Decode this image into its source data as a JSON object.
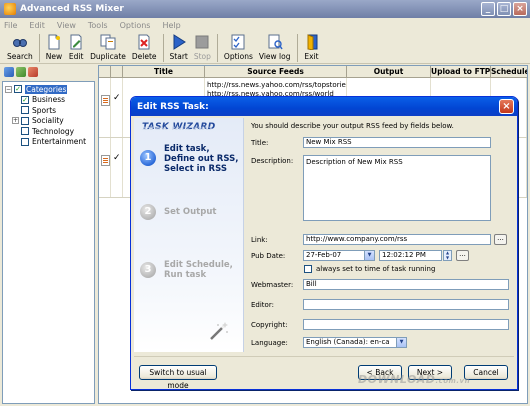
{
  "app": {
    "title": "Advanced RSS Mixer",
    "window_buttons": [
      "_",
      "□",
      "×"
    ]
  },
  "menu": [
    "File",
    "Edit",
    "View",
    "Tools",
    "Options",
    "Help"
  ],
  "toolbar": [
    {
      "label": "Search",
      "icon": "search-icon",
      "enabled": true
    },
    {
      "label": "New",
      "icon": "new-icon",
      "enabled": true
    },
    {
      "label": "Edit",
      "icon": "edit-icon",
      "enabled": true
    },
    {
      "label": "Duplicate",
      "icon": "duplicate-icon",
      "enabled": true
    },
    {
      "label": "Delete",
      "icon": "delete-icon",
      "enabled": true
    },
    {
      "label": "Start",
      "icon": "play-icon",
      "enabled": true
    },
    {
      "label": "Stop",
      "icon": "stop-icon",
      "enabled": false
    },
    {
      "label": "Options",
      "icon": "options-icon",
      "enabled": true
    },
    {
      "label": "View log",
      "icon": "log-icon",
      "enabled": true
    },
    {
      "label": "Exit",
      "icon": "exit-icon",
      "enabled": true
    }
  ],
  "tree": {
    "root": "Categories",
    "items": [
      {
        "label": "Business",
        "checked": true
      },
      {
        "label": "Sports",
        "checked": false
      },
      {
        "label": "Sociality",
        "checked": false,
        "expandable": true
      },
      {
        "label": "Technology",
        "checked": false
      },
      {
        "label": "Entertainment",
        "checked": false
      }
    ]
  },
  "grid": {
    "columns": [
      "",
      "",
      "Title",
      "Source Feeds",
      "Output",
      "Upload to FTP",
      "Schedule"
    ],
    "rows": [
      {
        "checked": true,
        "title": "",
        "feeds": [
          "http://rss.news.yahoo.com/rss/topstories",
          "http://rss.news.yahoo.com/rss/world"
        ],
        "output": "",
        "ftp": "",
        "schedule": ""
      },
      {
        "checked": true,
        "title": "",
        "feeds": [],
        "output": "",
        "ftp": "",
        "schedule": ""
      }
    ]
  },
  "dialog": {
    "title": "Edit RSS Task:",
    "close_glyph": "×",
    "wizard_title": "TASK WIZARD",
    "steps": [
      {
        "num": "1",
        "lines": [
          "Edit task,",
          "Define out RSS,",
          "Select in RSS"
        ],
        "active": true
      },
      {
        "num": "2",
        "lines": [
          "Set Output"
        ],
        "active": false
      },
      {
        "num": "3",
        "lines": [
          "Edit Schedule,",
          "Run task"
        ],
        "active": false
      }
    ],
    "instructions": "You should describe your output RSS feed by fields below.",
    "fields": {
      "title_label": "Title:",
      "title_value": "New Mix RSS",
      "description_label": "Description:",
      "description_value": "Description of New Mix RSS",
      "link_label": "Link:",
      "link_value": "http://www.company.com/rss",
      "pubdate_label": "Pub Date:",
      "pubdate_date": "27-Feb-07",
      "pubdate_time": "12:02:12 PM",
      "always_current_label": "always set to time of task running",
      "always_current_checked": false,
      "webmaster_label": "Webmaster:",
      "webmaster_value": "Bill",
      "editor_label": "Editor:",
      "editor_value": "",
      "copyright_label": "Copyright:",
      "copyright_value": "",
      "language_label": "Language:",
      "language_value": "English (Canada): en-ca",
      "browse_glyph": "..."
    },
    "buttons": {
      "switch": "Switch to usual mode",
      "back": "< Back",
      "next": "Next >",
      "cancel": "Cancel"
    }
  },
  "watermark": {
    "main": "DOWNLOAD",
    "suffix": ".com.vn"
  }
}
